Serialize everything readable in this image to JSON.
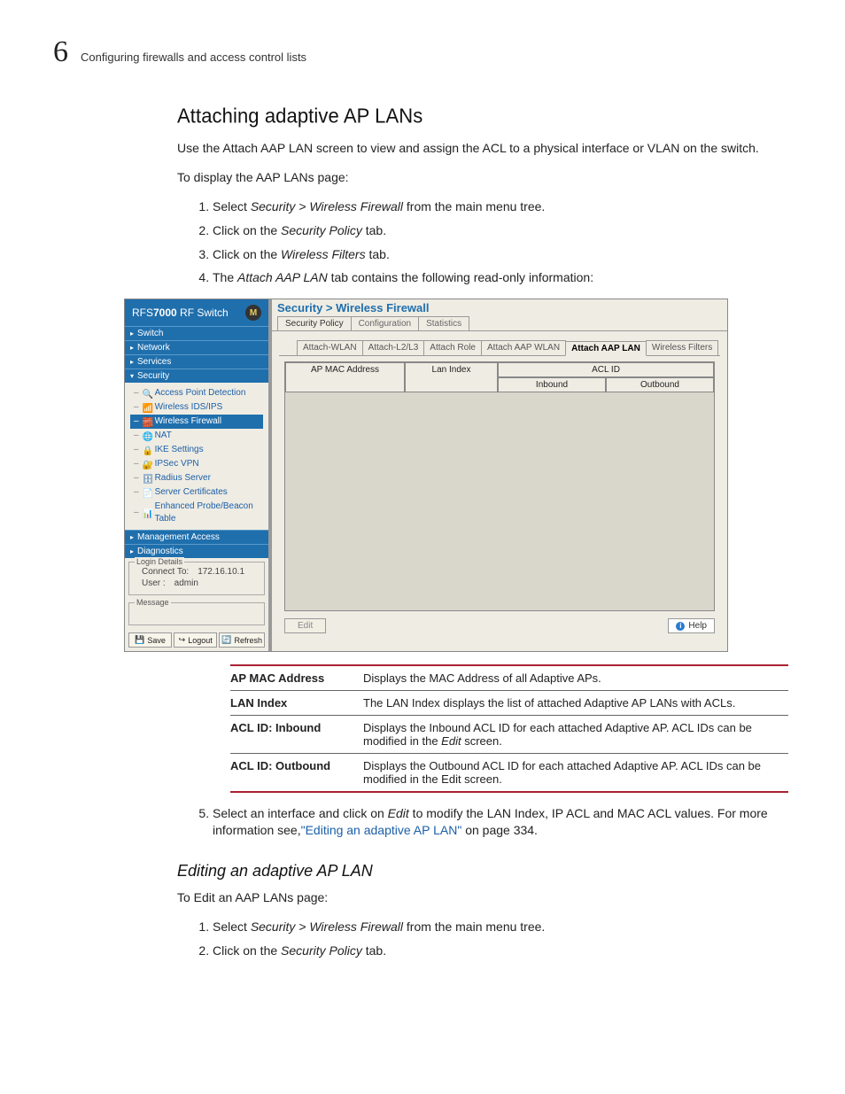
{
  "header": {
    "chapter_num": "6",
    "chapter_title": "Configuring firewalls and access control lists"
  },
  "section": {
    "title": "Attaching adaptive AP LANs",
    "intro": "Use the Attach AAP LAN screen to view and assign the ACL to a physical interface or VLAN on the switch.",
    "display_lead": "To display the AAP LANs page:",
    "steps": {
      "s1a": "Select ",
      "s1b": "Security > Wireless Firewall",
      "s1c": " from the main menu tree.",
      "s2a": "Click on the ",
      "s2b": "Security Policy",
      "s2c": " tab.",
      "s3a": "Click on the ",
      "s3b": "Wireless Filters",
      "s3c": " tab.",
      "s4a": "The ",
      "s4b": "Attach AAP LAN",
      "s4c": " tab contains the following read-only information:"
    },
    "step5": {
      "a": "Select an interface and click on ",
      "b": "Edit",
      "c": " to modify the LAN Index, IP ACL and MAC ACL values. For more information see,",
      "link": "\"Editing an adaptive AP LAN\"",
      "d": " on page 334."
    }
  },
  "shot": {
    "product_a": "RFS",
    "product_b": "7000",
    "product_c": " RF Switch",
    "logo": "M",
    "nav": {
      "switch": "Switch",
      "network": "Network",
      "services": "Services",
      "security": "Security",
      "mgmt": "Management Access",
      "diag": "Diagnostics"
    },
    "tree": {
      "apd": "Access Point Detection",
      "ids": "Wireless IDS/IPS",
      "wf": "Wireless Firewall",
      "nat": "NAT",
      "ike": "IKE Settings",
      "ipsec": "IPSec VPN",
      "radius": "Radius Server",
      "cert": "Server Certificates",
      "probe": "Enhanced Probe/Beacon Table"
    },
    "login": {
      "legend": "Login Details",
      "connect_k": "Connect To:",
      "connect_v": "172.16.10.1",
      "user_k": "User :",
      "user_v": "admin"
    },
    "message_legend": "Message",
    "btns": {
      "save": "Save",
      "logout": "Logout",
      "refresh": "Refresh"
    },
    "breadcrumb": "Security > Wireless Firewall",
    "tabs1": {
      "a": "Security Policy",
      "b": "Configuration",
      "c": "Statistics"
    },
    "tabs2": {
      "a": "Attach-WLAN",
      "b": "Attach-L2/L3",
      "c": "Attach Role",
      "d": "Attach AAP WLAN",
      "e": "Attach AAP LAN",
      "f": "Wireless Filters"
    },
    "cols": {
      "apmac": "AP MAC Address",
      "lan": "Lan Index",
      "acl": "ACL ID",
      "in": "Inbound",
      "out": "Outbound"
    },
    "edit": "Edit",
    "help": "Help"
  },
  "desc": {
    "r1k": "AP MAC Address",
    "r1v": "Displays the MAC Address of all Adaptive APs.",
    "r2k": "LAN Index",
    "r2v": "The LAN Index displays the list of attached Adaptive AP LANs with ACLs.",
    "r3k": "ACL ID: Inbound",
    "r3v_a": "Displays the Inbound ACL ID for each attached Adaptive AP. ACL IDs can be modified in the ",
    "r3v_b": "Edit",
    "r3v_c": " screen.",
    "r4k": "ACL ID: Outbound",
    "r4v": "Displays the Outbound ACL ID for each attached Adaptive AP. ACL IDs can be modified in the Edit screen."
  },
  "sub": {
    "title": "Editing an adaptive AP LAN",
    "lead": "To Edit an AAP LANs page:",
    "s1a": "Select ",
    "s1b": "Security > Wireless Firewall",
    "s1c": " from the main menu tree.",
    "s2a": "Click on the ",
    "s2b": "Security Policy",
    "s2c": " tab."
  }
}
